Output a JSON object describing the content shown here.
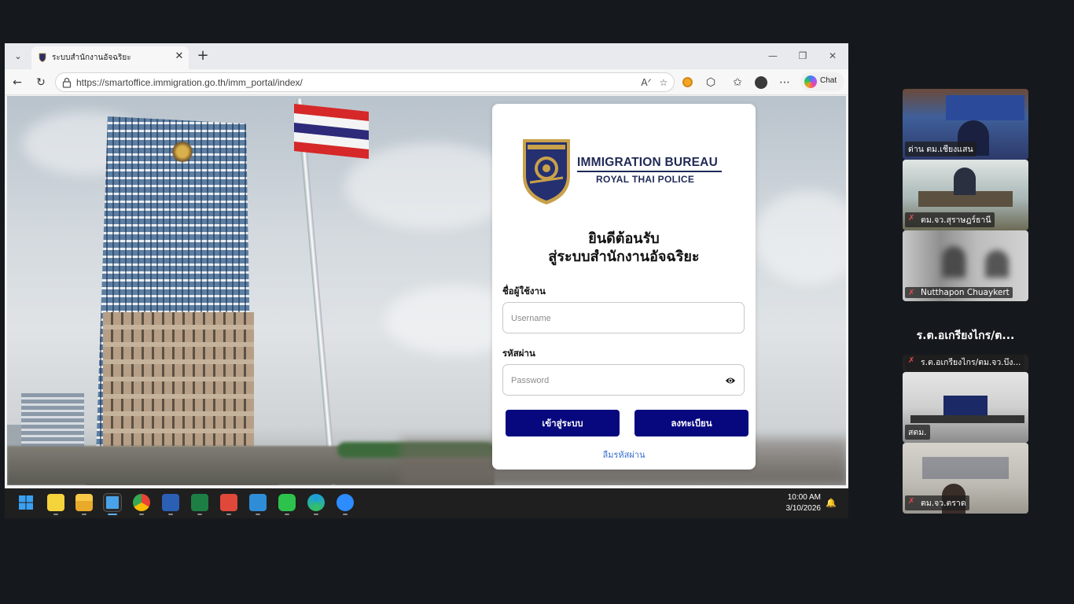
{
  "browser": {
    "tab_title": "ระบบสำนักงานอัจฉริยะ",
    "url": "https://smartoffice.immigration.go.th/imm_portal/index/",
    "chat_label": "Chat",
    "icons": [
      "tab-list-icon",
      "close-icon",
      "plus-icon",
      "minimize-icon",
      "restore-icon",
      "close-icon",
      "back-icon",
      "refresh-icon",
      "lock-icon",
      "read-aloud-icon",
      "favorite-star-icon",
      "extension-icon",
      "puzzle-icon",
      "favorites-icon",
      "profile-icon",
      "more-icon",
      "copilot-icon"
    ]
  },
  "login": {
    "brand_line1": "IMMIGRATION BUREAU",
    "brand_line2": "ROYAL THAI POLICE",
    "welcome_line1": "ยินดีต้อนรับ",
    "welcome_line2": "สู่ระบบสำนักงานอัจฉริยะ",
    "username_label": "ชื่อผู้ใช้งาน",
    "username_placeholder": "Username",
    "password_label": "รหัสผ่าน",
    "password_placeholder": "Password",
    "login_button": "เข้าสู่ระบบ",
    "register_button": "ลงทะเบียน",
    "forgot_link": "ลืมรหัสผ่าน",
    "colors": {
      "button": "#07077e",
      "brand": "#1f2a56",
      "link": "#3b6fd0"
    }
  },
  "taskbar": {
    "apps": [
      "windows-start-icon",
      "sticky-notes-icon",
      "file-explorer-icon",
      "notepad-icon",
      "chrome-icon",
      "word-icon",
      "excel-icon",
      "wps-icon",
      "s-app-icon",
      "line-icon",
      "edge-icon",
      "zoom-icon"
    ],
    "time": "10:00 AM",
    "date": "3/10/2026"
  },
  "participants": {
    "tile1_name": "ด่าน ตม.เชียงแสน",
    "tile2_name": "ตม.จว.สุราษฎร์ธานี",
    "tile3_name": "Nutthapon Chuaykert",
    "active_speaker_heading": "ร.ต.อเกรียงไกร/ต...",
    "tile4_name": "ร.ต.อเกรียงไกร/ตม.จว.บึง...",
    "tile5_name": "สตม.",
    "tile6_name": "ตม.จว.ตราด"
  }
}
